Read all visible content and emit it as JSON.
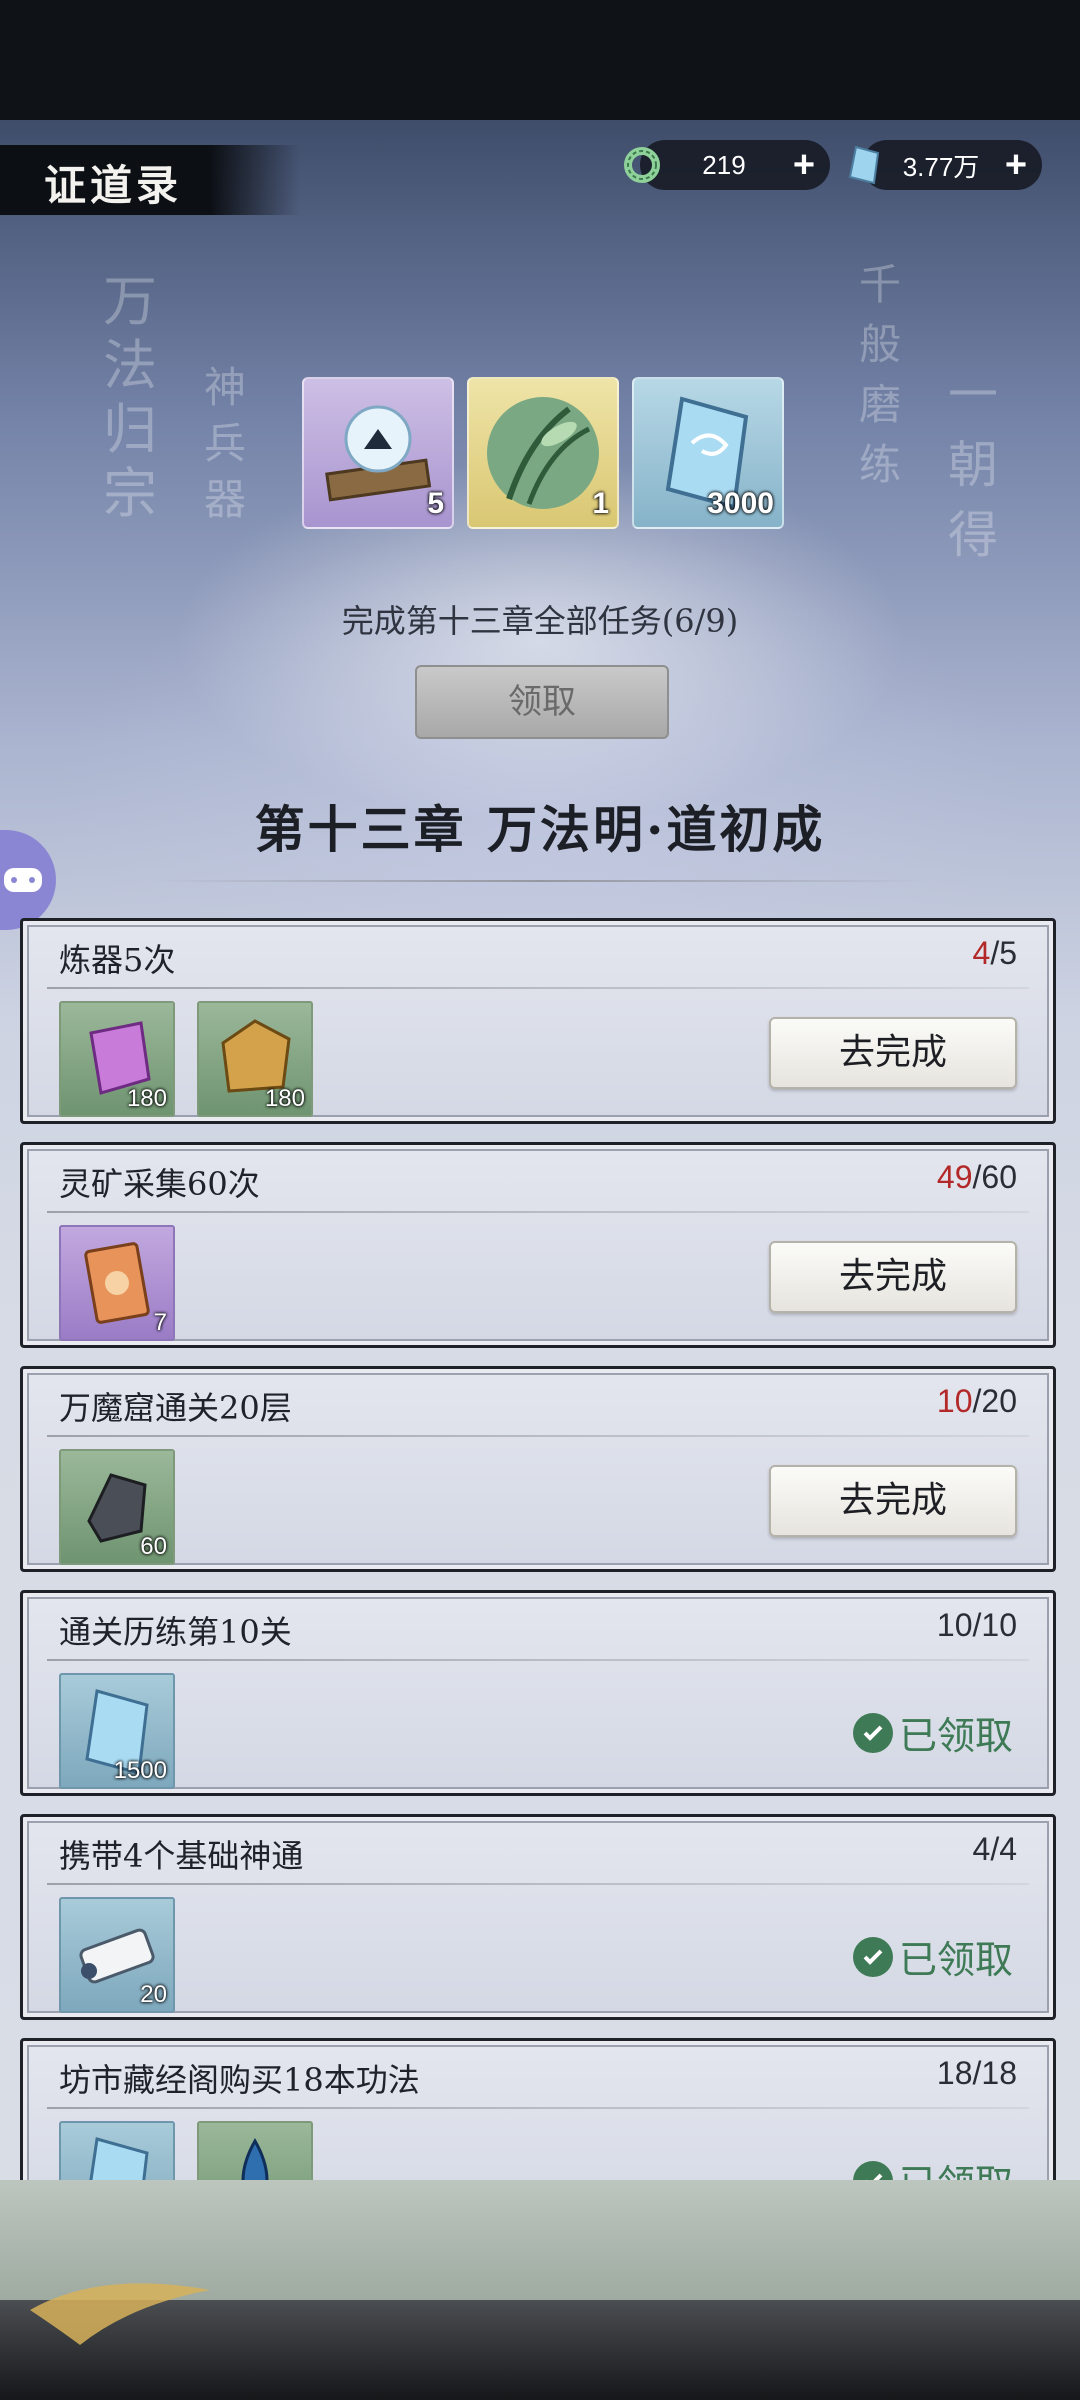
{
  "header": {
    "title": "证道录",
    "resources": [
      {
        "icon": "jade-ring-icon",
        "value": "219",
        "plus": "+"
      },
      {
        "icon": "spirit-crystal-icon",
        "value": "3.77万",
        "plus": "+"
      }
    ]
  },
  "background_calligraphy": {
    "left_1": "万法归宗",
    "left_2": "神兵器",
    "right_1": "千般磨练",
    "right_2": "一朝得"
  },
  "chapter_reward": {
    "items": [
      {
        "icon": "scroll-orb-icon",
        "qty": "5",
        "color": "#b9a8d6"
      },
      {
        "icon": "bamboo-forest-icon",
        "qty": "1",
        "color": "#e2d694"
      },
      {
        "icon": "spirit-crystal-icon",
        "qty": "3000",
        "color": "#9fc6d8"
      }
    ],
    "task_text": "完成第十三章全部任务(6/9)",
    "claim_label": "领取"
  },
  "chapter": {
    "title": "第十三章 万法明·道初成"
  },
  "tasks": [
    {
      "name": "炼器5次",
      "progress_current": "4",
      "progress_total": "/5",
      "items": [
        {
          "icon": "purple-crystal-icon",
          "qty": "180"
        },
        {
          "icon": "gold-ore-icon",
          "qty": "180"
        }
      ],
      "action": "去完成"
    },
    {
      "name": "灵矿采集60次",
      "progress_current": "49",
      "progress_total": "/60",
      "items": [
        {
          "icon": "talisman-scroll-icon",
          "qty": "7"
        }
      ],
      "action": "去完成"
    },
    {
      "name": "万魔窟通关20层",
      "progress_current": "10",
      "progress_total": "/20",
      "items": [
        {
          "icon": "iron-ore-icon",
          "qty": "60"
        }
      ],
      "action": "去完成"
    },
    {
      "name": "通关历练第10关",
      "progress_current": "10",
      "progress_total": "/10",
      "items": [
        {
          "icon": "spirit-crystal-icon",
          "qty": "1500"
        }
      ],
      "action": "已领取"
    },
    {
      "name": "携带4个基础神通",
      "progress_current": "4",
      "progress_total": "/4",
      "items": [
        {
          "icon": "skill-scroll-icon",
          "qty": "20"
        }
      ],
      "action": "已领取"
    },
    {
      "name": "坊市藏经阁购买18本功法",
      "progress_current": "18",
      "progress_total": "/18",
      "items": [
        {
          "icon": "spirit-crystal-icon",
          "qty": ""
        },
        {
          "icon": "water-drop-icon",
          "qty": ""
        }
      ],
      "action": "已领取"
    }
  ],
  "colors": {
    "progress_incomplete": "#b32828",
    "claimed_green": "#3d7a55"
  }
}
